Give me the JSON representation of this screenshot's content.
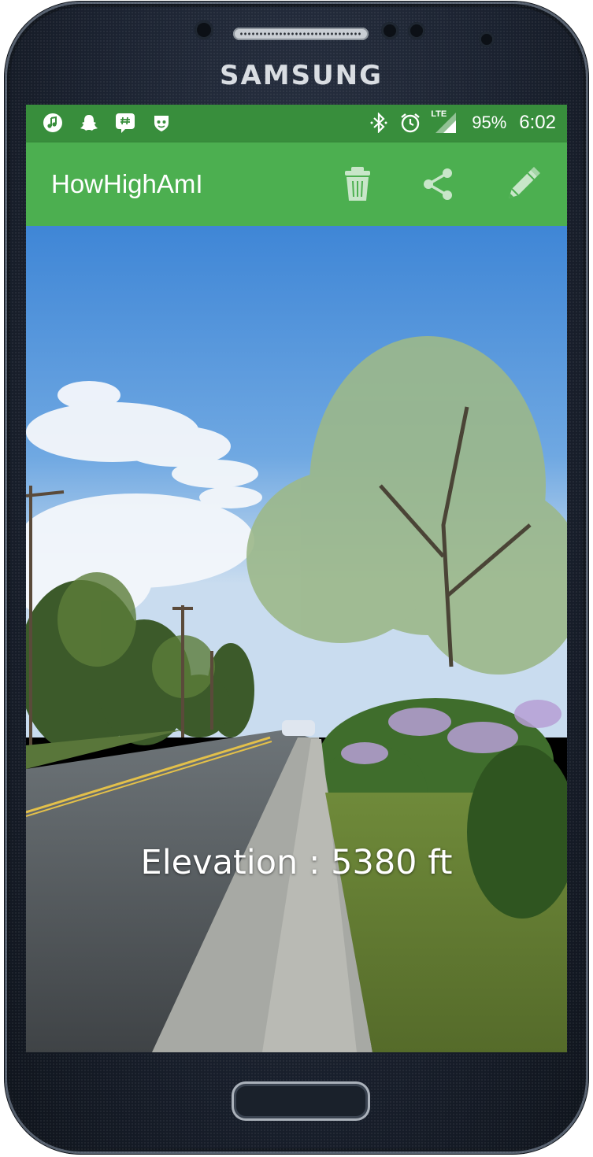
{
  "device": {
    "brand": "SAMSUNG"
  },
  "statusbar": {
    "notification_icons": [
      "music-note-icon",
      "snapchat-ghost-icon",
      "hangouts-icon",
      "shield-icon"
    ],
    "system_icons": [
      "bluetooth-icon",
      "alarm-icon",
      "lte-signal-icon"
    ],
    "network_label": "LTE",
    "battery": "95%",
    "time": "6:02"
  },
  "appbar": {
    "title": "HowHighAmI",
    "actions": [
      "delete-icon",
      "share-icon",
      "edit-icon"
    ]
  },
  "main": {
    "elevation_text": "Elevation : 5380 ft"
  },
  "colors": {
    "statusbar": "#388e3c",
    "appbar": "#4caf50",
    "icon_tint": "#ffffff"
  }
}
